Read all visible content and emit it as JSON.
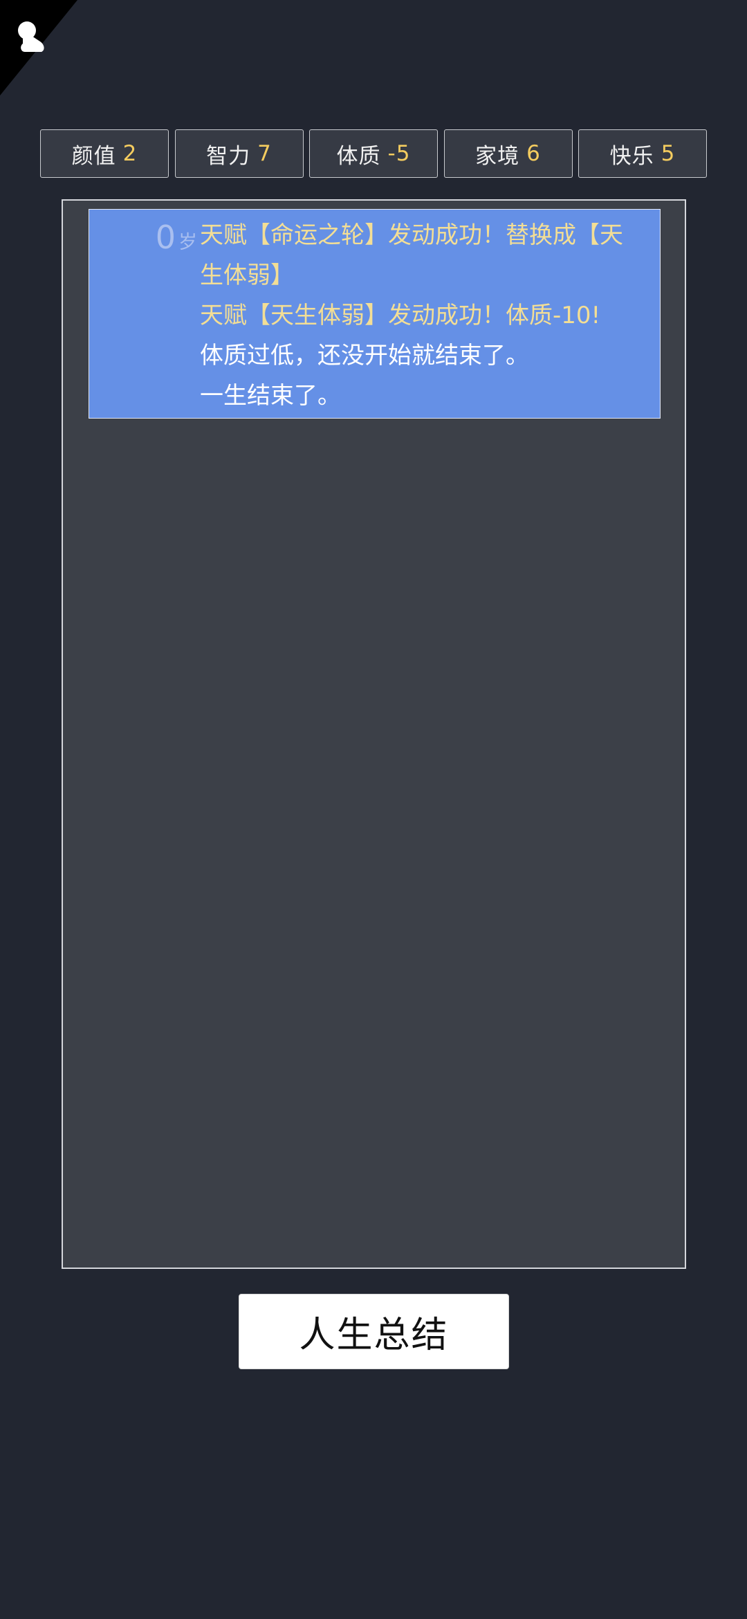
{
  "corner": {
    "icon": "pawn-icon"
  },
  "stats": [
    {
      "label": "颜值",
      "value": "2"
    },
    {
      "label": "智力",
      "value": "7"
    },
    {
      "label": "体质",
      "value": "-5"
    },
    {
      "label": "家境",
      "value": "6"
    },
    {
      "label": "快乐",
      "value": "5"
    }
  ],
  "log": {
    "entries": [
      {
        "age": "0",
        "age_unit": "岁",
        "lines": [
          "天赋【命运之轮】发动成功！替换成【天",
          "生体弱】",
          "天赋【天生体弱】发动成功！体质-10!",
          "体质过低，还没开始就结束了。",
          "一生结束了。"
        ]
      }
    ]
  },
  "actions": {
    "summary_label": "人生总结"
  },
  "colors": {
    "background": "#222631",
    "panel": "#3c4048",
    "entry": "#6590e6",
    "value_accent": "#f4cc5f",
    "highlight_text": "#f3de95"
  }
}
